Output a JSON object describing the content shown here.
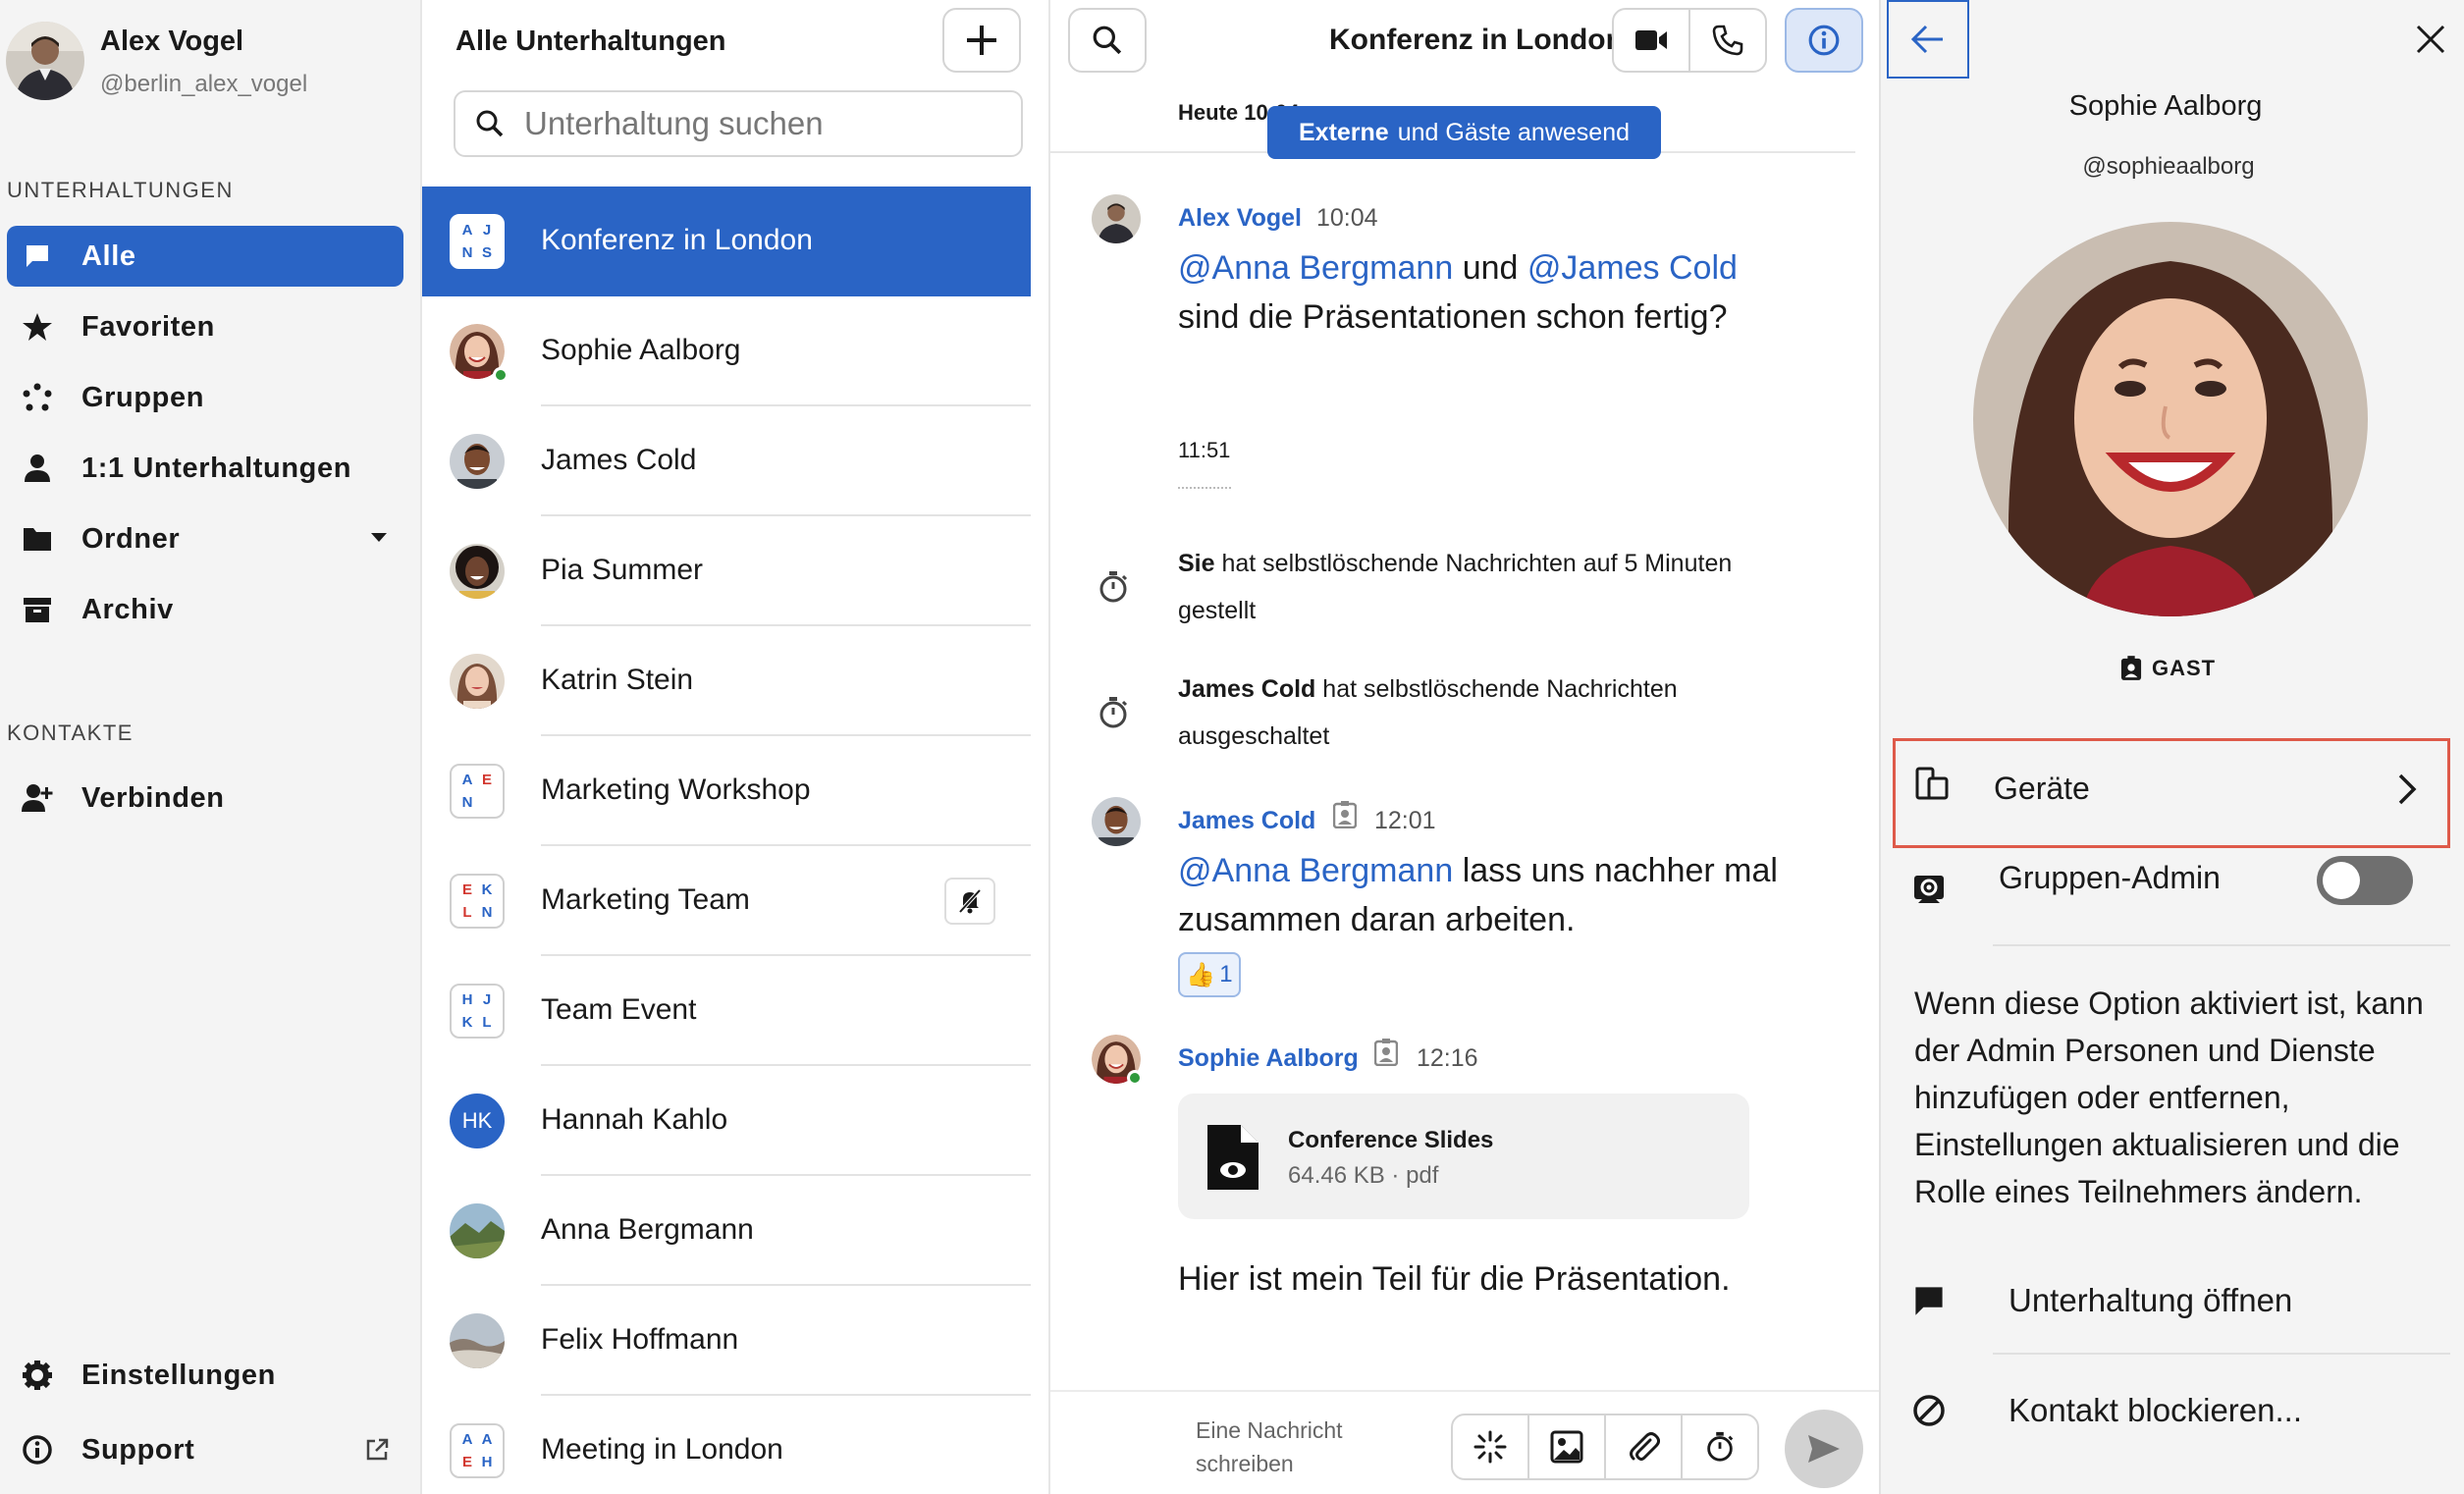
{
  "user": {
    "name": "Alex Vogel",
    "handle": "@berlin_alex_vogel"
  },
  "sidebar": {
    "conversations_header": "UNTERHALTUNGEN",
    "items": [
      {
        "label": "Alle",
        "icon": "chat-bubble-icon"
      },
      {
        "label": "Favoriten",
        "icon": "star-icon"
      },
      {
        "label": "Gruppen",
        "icon": "groups-icon"
      },
      {
        "label": "1:1 Unterhaltungen",
        "icon": "person-icon"
      },
      {
        "label": "Ordner",
        "icon": "folder-icon"
      },
      {
        "label": "Archiv",
        "icon": "archive-icon"
      }
    ],
    "contacts_header": "KONTAKTE",
    "connect_label": "Verbinden",
    "settings_label": "Einstellungen",
    "support_label": "Support"
  },
  "convlist": {
    "title": "Alle Unterhaltungen",
    "search_placeholder": "Unterhaltung suchen",
    "items": [
      {
        "name": "Konferenz in London",
        "initials": [
          "A",
          "J",
          "N",
          "S"
        ]
      },
      {
        "name": "Sophie Aalborg"
      },
      {
        "name": "James Cold"
      },
      {
        "name": "Pia Summer"
      },
      {
        "name": "Katrin Stein"
      },
      {
        "name": "Marketing Workshop",
        "initials": [
          "A",
          "E",
          "N",
          ""
        ]
      },
      {
        "name": "Marketing Team",
        "initials": [
          "E",
          "K",
          "L",
          "N"
        ]
      },
      {
        "name": "Team Event",
        "initials": [
          "H",
          "J",
          "K",
          "L"
        ]
      },
      {
        "name": "Hannah Kahlo",
        "initials_round": "HK"
      },
      {
        "name": "Anna Bergmann"
      },
      {
        "name": "Felix Hoffmann"
      },
      {
        "name": "Meeting in London",
        "initials": [
          "A",
          "A",
          "E",
          "H"
        ]
      }
    ]
  },
  "chat": {
    "title": "Konferenz in London",
    "date_label": "Heute 10:04",
    "guests_pill": {
      "bold": "Externe",
      "rest": "und Gäste anwesend"
    },
    "msg1": {
      "author": "Alex Vogel",
      "time": "10:04",
      "mention1": "@Anna Bergmann",
      "and": "und",
      "mention2": "@James Cold",
      "line2": "sind die Präsentationen schon fertig?"
    },
    "timer_time": "11:51",
    "sys1": {
      "who": "Sie",
      "text": "hat selbstlöschende Nachrichten auf 5 Minuten gestellt"
    },
    "sys2": {
      "who": "James Cold",
      "text": "hat selbstlöschende Nachrichten ausgeschaltet"
    },
    "msg2": {
      "author": "James Cold",
      "time": "12:01",
      "mention": "@Anna Bergmann",
      "text1": "lass uns nachher mal",
      "text2": "zusammen daran arbeiten.",
      "reaction_emoji": "👍",
      "reaction_count": "1"
    },
    "msg3": {
      "author": "Sophie Aalborg",
      "time": "12:16",
      "file_name": "Conference Slides",
      "file_meta": "64.46 KB · pdf",
      "text": "Hier ist mein Teil für die Präsentation."
    },
    "composer_placeholder": "Eine Nachricht schreiben"
  },
  "panel": {
    "name": "Sophie Aalborg",
    "handle": "@sophieaalborg",
    "role": "GAST",
    "devices_label": "Geräte",
    "admin_label": "Gruppen-Admin",
    "admin_toggle": false,
    "admin_desc": "Wenn diese Option aktiviert ist, kann der Admin Personen und Dienste hinzufügen oder entfernen, Einstellungen aktualisieren und die Rolle eines Teilnehmers ändern.",
    "open_conversation": "Unterhaltung öffnen",
    "block_contact": "Kontakt blockieren..."
  },
  "colors": {
    "accent": "#2a64c5",
    "highlight_border": "#de5a4a",
    "online": "#2f9a3c"
  }
}
